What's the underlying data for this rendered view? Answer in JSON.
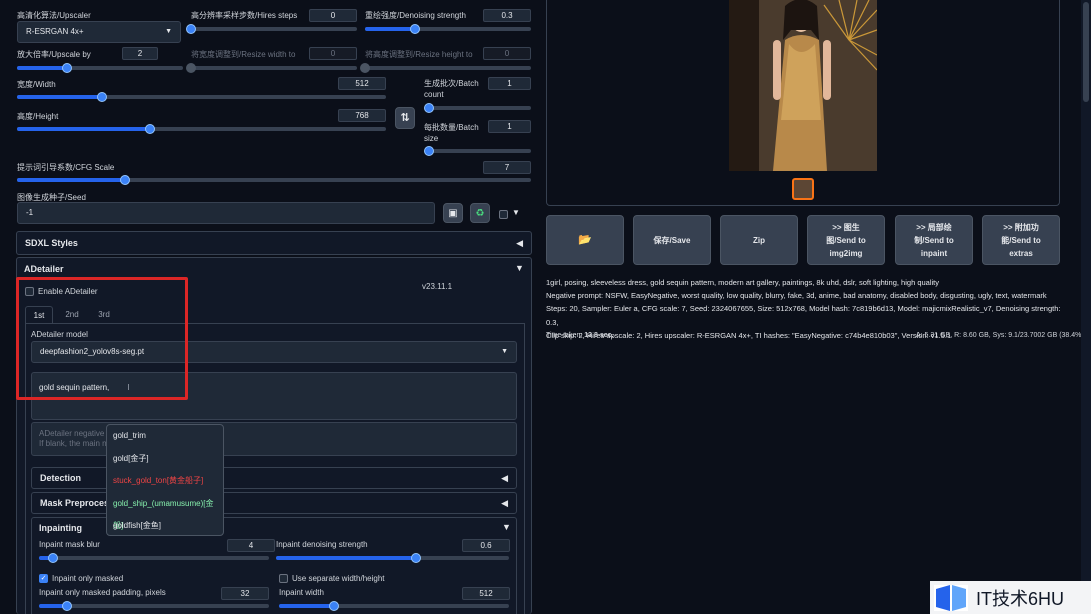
{
  "hires": {
    "upscaler_label": "高清化算法/Upscaler",
    "upscaler_value": "R-ESRGAN 4x+",
    "steps_label": "高分辨率采样步数/Hires steps",
    "steps_value": "0",
    "denoise_label": "重绘强度/Denoising strength",
    "denoise_value": "0.3",
    "upscale_by_label": "放大倍率/Upscale by",
    "upscale_by_value": "2",
    "resize_w_label": "将宽度调整到/Resize width to",
    "resize_w_value": "0",
    "resize_h_label": "将高度调整到/Resize height to",
    "resize_h_value": "0"
  },
  "size": {
    "width_label": "宽度/Width",
    "width_value": "512",
    "height_label": "高度/Height",
    "height_value": "768",
    "batch_count_label_1": "生成批次/Batch",
    "batch_count_label_2": "count",
    "batch_count_value": "1",
    "batch_size_label_1": "每批数量/Batch",
    "batch_size_label_2": "size",
    "batch_size_value": "1",
    "swap_icon": "⇅"
  },
  "cfg": {
    "label": "提示词引导系数/CFG Scale",
    "value": "7"
  },
  "seed": {
    "label": "图像生成种子/Seed",
    "value": "-1",
    "dice_icon": "▣",
    "recycle_icon": "♻"
  },
  "sdxl": {
    "label": "SDXL Styles"
  },
  "adetailer": {
    "label": "ADetailer",
    "enable_label": "Enable ADetailer",
    "version": "v23.11.1",
    "tabs": [
      "1st",
      "2nd",
      "3rd"
    ],
    "model_label": "ADetailer model",
    "model_value": "deepfashion2_yolov8s-seg.pt",
    "prompt_value": "gold sequin pattern,",
    "neg_placeholder_1": "ADetailer negative pr",
    "neg_placeholder_2": "If blank, the main ne",
    "detection_label": "Detection",
    "mask_label": "Mask Preprocessi",
    "inpainting_label": "Inpainting",
    "mask_blur_label": "Inpaint mask blur",
    "mask_blur_value": "4",
    "inpaint_denoise_label": "Inpaint denoising strength",
    "inpaint_denoise_value": "0.6",
    "only_masked_label": "Inpaint only masked",
    "separate_wh_label": "Use separate width/height",
    "padding_label": "Inpaint only masked padding, pixels",
    "padding_value": "32",
    "inpaint_width_label": "Inpaint width",
    "inpaint_width_value": "512"
  },
  "autocomplete": [
    {
      "text": "gold_trim",
      "color": "#e5e7eb"
    },
    {
      "text": "gold[金子]",
      "color": "#e5e7eb"
    },
    {
      "text": "stuck_gold_ton[黄金船子]",
      "color": "#ef4444"
    },
    {
      "text": "gold_ship_(umamusume)[金船]",
      "color": "#86efac"
    },
    {
      "text": "goldfish[金鱼]",
      "color": "#e5e7eb"
    }
  ],
  "actions": {
    "folder_icon": "📂",
    "save": "保存/Save",
    "zip": "Zip",
    "img2img": [
      ">> 图生",
      "图/Send to",
      "img2img"
    ],
    "inpaint": [
      ">> 局部绘",
      "制/Send to",
      "inpaint"
    ],
    "extras": [
      ">> 附加功",
      "能/Send to",
      "extras"
    ]
  },
  "info": {
    "line1": "1girl, posing, sleeveless dress, gold sequin pattern, modern art gallery, paintings, 8k uhd, dslr, soft lighting, high quality",
    "line2": "Negative prompt: NSFW, EasyNegative, worst quality, low quality, blurry, fake, 3d, anime, bad anatomy, disabled body, disgusting, ugly, text, watermark",
    "line3": "Steps: 20, Sampler: Euler a, CFG scale: 7, Seed: 2324067655, Size: 512x768, Model hash: 7c819b6d13, Model: majicmixRealistic_v7, Denoising strength: 0.3,",
    "line4": "Clip skip: 2, Hires upscale: 2, Hires upscaler: R-ESRGAN 4x+, TI hashes: \"EasyNegative: c74b4e810b03\", Version: v1.5.1",
    "time_label": "Time taken:",
    "time_value": "13.8 sec.",
    "vram": "A: 5.31 GB, R: 8.60 GB, Sys: 9.1/23.7002 GB (38.4%)"
  },
  "watermark": {
    "text": "IT技术6HU"
  },
  "colors": {
    "accent": "#3b82f6",
    "highlight_box": "#dc2626",
    "bg": "#0b0f19"
  }
}
